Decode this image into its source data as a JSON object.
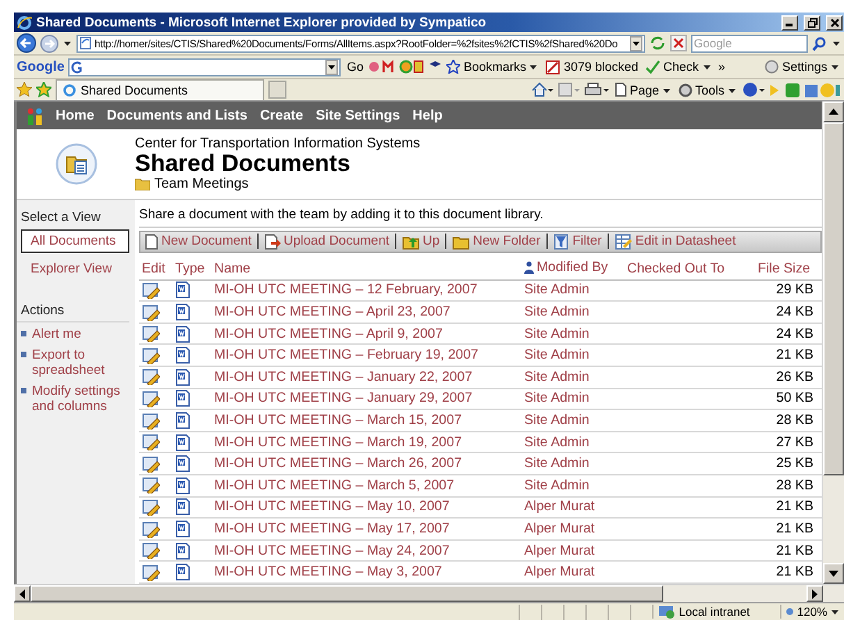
{
  "window": {
    "title": "Shared Documents - Microsoft Internet Explorer provided by Sympatico"
  },
  "address_bar": {
    "url": "http://homer/sites/CTIS/Shared%20Documents/Forms/AllItems.aspx?RootFolder=%2fsites%2fCTIS%2fShared%20Do",
    "search_placeholder": "Google"
  },
  "google_toolbar": {
    "logo": "Google",
    "go": "Go",
    "bookmarks": "Bookmarks",
    "blocked": "3079 blocked",
    "check": "Check",
    "more": "»",
    "settings": "Settings"
  },
  "tabs": [
    {
      "label": "Shared Documents",
      "selected": true
    }
  ],
  "command_bar": {
    "page": "Page",
    "tools": "Tools"
  },
  "nav": {
    "items": [
      "Home",
      "Documents and Lists",
      "Create",
      "Site Settings",
      "Help"
    ]
  },
  "site": {
    "name": "Center for Transportation Information Systems",
    "title": "Shared Documents",
    "folder": "Team Meetings"
  },
  "sidebar": {
    "views_heading": "Select a View",
    "views": [
      {
        "label": "All Documents",
        "selected": true
      },
      {
        "label": "Explorer View",
        "selected": false
      }
    ],
    "actions_heading": "Actions",
    "actions": [
      "Alert me",
      "Export to spreadsheet",
      "Modify settings and columns"
    ]
  },
  "description": "Share a document with the team by adding it to this document library.",
  "toolbar": [
    {
      "kind": "new",
      "label": "New Document"
    },
    {
      "kind": "upload",
      "label": "Upload Document"
    },
    {
      "kind": "up",
      "label": "Up"
    },
    {
      "kind": "folder",
      "label": "New Folder"
    },
    {
      "kind": "filter",
      "label": "Filter"
    },
    {
      "kind": "datasheet",
      "label": "Edit in Datasheet"
    }
  ],
  "table": {
    "columns": [
      "Edit",
      "Type",
      "Name",
      "Modified By",
      "Checked Out To",
      "File Size"
    ],
    "rows": [
      {
        "name": "MI-OH UTC MEETING – 12 February, 2007",
        "modified_by": "Site Admin",
        "size": "29 KB"
      },
      {
        "name": "MI-OH UTC MEETING – April 23, 2007",
        "modified_by": "Site Admin",
        "size": "24 KB"
      },
      {
        "name": "MI-OH UTC MEETING – April 9, 2007",
        "modified_by": "Site Admin",
        "size": "24 KB"
      },
      {
        "name": "MI-OH UTC MEETING – February 19, 2007",
        "modified_by": "Site Admin",
        "size": "21 KB"
      },
      {
        "name": "MI-OH UTC MEETING – January 22, 2007",
        "modified_by": "Site Admin",
        "size": "26 KB"
      },
      {
        "name": "MI-OH UTC MEETING – January 29, 2007",
        "modified_by": "Site Admin",
        "size": "50 KB"
      },
      {
        "name": "MI-OH UTC MEETING – March 15, 2007",
        "modified_by": "Site Admin",
        "size": "28 KB"
      },
      {
        "name": "MI-OH UTC MEETING – March 19, 2007",
        "modified_by": "Site Admin",
        "size": "27 KB"
      },
      {
        "name": "MI-OH UTC MEETING – March 26, 2007",
        "modified_by": "Site Admin",
        "size": "25 KB"
      },
      {
        "name": "MI-OH UTC MEETING – March 5, 2007",
        "modified_by": "Site Admin",
        "size": "28 KB"
      },
      {
        "name": "MI-OH UTC MEETING – May 10, 2007",
        "modified_by": "Alper Murat",
        "size": "21 KB"
      },
      {
        "name": "MI-OH UTC MEETING – May 17, 2007",
        "modified_by": "Alper Murat",
        "size": "21 KB"
      },
      {
        "name": "MI-OH UTC MEETING – May 24, 2007",
        "modified_by": "Alper Murat",
        "size": "21 KB"
      },
      {
        "name": "MI-OH UTC MEETING – May 3, 2007",
        "modified_by": "Alper Murat",
        "size": "21 KB"
      }
    ]
  },
  "status_bar": {
    "zone": "Local intranet",
    "zoom": "120%"
  }
}
